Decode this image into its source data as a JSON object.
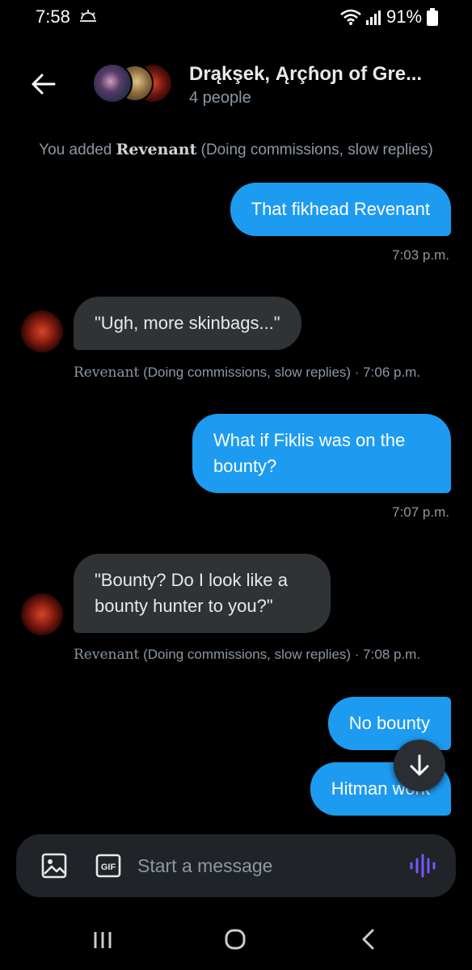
{
  "status_bar": {
    "time": "7:58",
    "battery": "91%"
  },
  "header": {
    "title": "Drąkşek, Ąrçɦoɲ of Gre...",
    "subtitle": "4 people"
  },
  "system_note": {
    "prefix": "You added ",
    "name": "Revenant",
    "suffix": " (Doing commissions, slow replies)"
  },
  "messages": [
    {
      "text": "That fikhead Revenant",
      "time": "7:03 p.m."
    },
    {
      "text": "\"Ugh, more skinbags...\"",
      "sender": "Revenant",
      "sender_suffix": " (Doing commissions, slow replies) · 7:06 p.m."
    },
    {
      "text": "What if Fiklis was on the bounty?",
      "time": "7:07 p.m."
    },
    {
      "text": "\"Bounty? Do I look like a bounty hunter to you?\"",
      "sender": "Revenant",
      "sender_suffix": " (Doing commissions, slow replies) · 7:08 p.m."
    },
    {
      "text": "No bounty"
    },
    {
      "text": "Hitman work"
    }
  ],
  "composer": {
    "placeholder": "Start a message",
    "gif_label": "GIF"
  },
  "icons": {
    "back": "back-arrow-icon",
    "image": "image-icon",
    "gif": "gif-icon",
    "voice": "voice-wave-icon",
    "scroll_down": "arrow-down-icon"
  },
  "colors": {
    "outgoing_bubble": "#1d9bf0",
    "incoming_bubble": "#2f3336",
    "voice_accent": "#7856ff"
  }
}
